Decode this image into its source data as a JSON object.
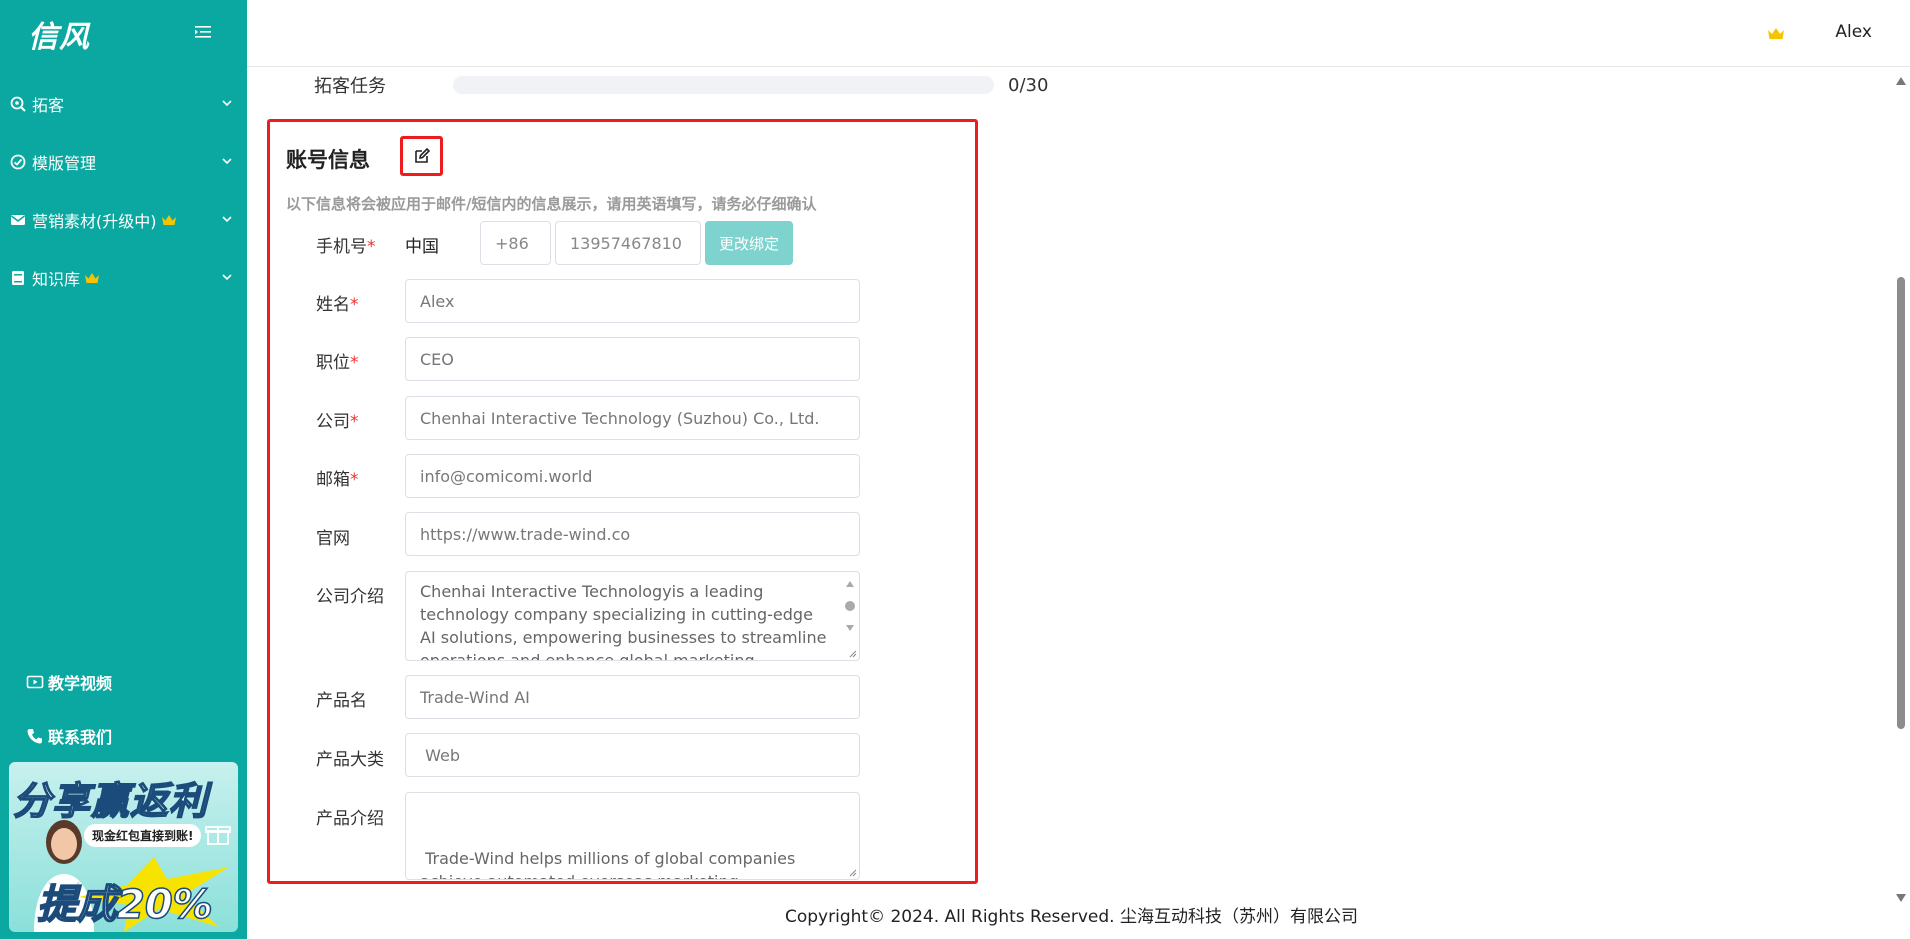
{
  "app": {
    "logo": "信风"
  },
  "sidebar": {
    "items": [
      {
        "label": "拓客",
        "icon": "search-target-icon",
        "crown": false
      },
      {
        "label": "模版管理",
        "icon": "check-circle-icon",
        "crown": false
      },
      {
        "label": "营销素材(升级中)",
        "icon": "mail-icon",
        "crown": true
      },
      {
        "label": "知识库",
        "icon": "book-icon",
        "crown": true
      }
    ],
    "bottom_links": [
      {
        "label": "教学视频",
        "icon": "video-icon"
      },
      {
        "label": "联系我们",
        "icon": "phone-icon"
      }
    ],
    "banner": {
      "title": "分享赢返利",
      "subtitle": "现金红包直接到账!",
      "big": "提成20%"
    }
  },
  "header": {
    "user": "Alex"
  },
  "task": {
    "label": "拓客任务",
    "value": "0/30",
    "progress": 0
  },
  "account": {
    "title": "账号信息",
    "hint": "以下信息将会被应用于邮件/短信内的信息展示，请用英语填写，请务必仔细确认",
    "phone": {
      "label": "手机号",
      "country": "中国",
      "code_placeholder": "+86",
      "number": "13957467810",
      "rebind": "更改绑定"
    },
    "name": {
      "label": "姓名",
      "value": "Alex"
    },
    "position": {
      "label": "职位",
      "value": "CEO"
    },
    "company": {
      "label": "公司",
      "value": "Chenhai Interactive Technology (Suzhou) Co., Ltd."
    },
    "email": {
      "label": "邮箱",
      "value": "info@comicomi.world"
    },
    "website": {
      "label": "官网",
      "value": "https://www.trade-wind.co"
    },
    "company_intro": {
      "label": "公司介绍",
      "value": "Chenhai Interactive Technologyis a leading technology company specializing in cutting-edge AI solutions, empowering businesses to streamline operations and enhance global marketing strategies."
    },
    "product_name": {
      "label": "产品名",
      "value": "Trade-Wind AI"
    },
    "product_category": {
      "label": "产品大类",
      "value": " Web"
    },
    "product_intro": {
      "label": "产品介绍",
      "value": " Trade-Wind helps millions of global companies achieve automated overseas marketing."
    }
  },
  "footer": {
    "text": "Copyright© 2024. All Rights Reserved. 尘海互动科技（苏州）有限公司"
  },
  "colors": {
    "sidebar": "#0aa8a0",
    "highlight": "#ee1c1c",
    "rebind_button": "#7fd3cf",
    "crown": "#f5c400"
  }
}
